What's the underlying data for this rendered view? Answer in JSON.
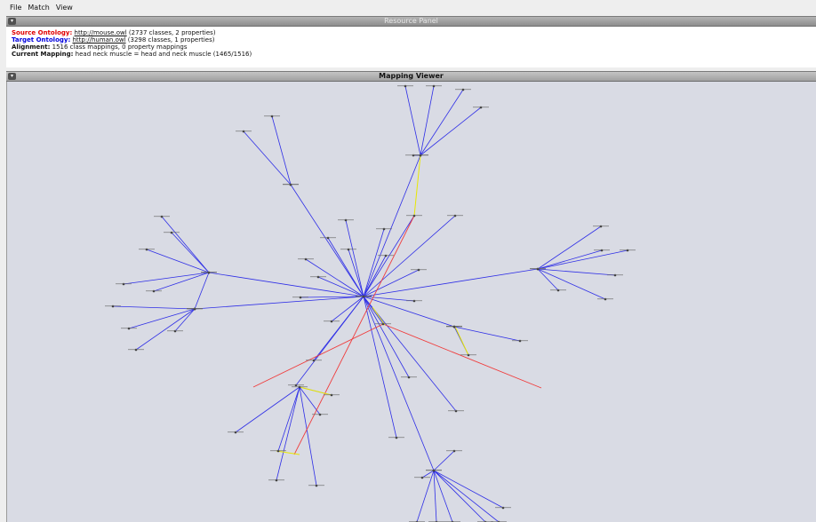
{
  "menu": [
    "File",
    "Match",
    "View"
  ],
  "resource_panel": {
    "title": "Resource Panel",
    "source_label": "Source Ontology:",
    "source_link": "http://mouse.owl",
    "source_info": " (2737 classes, 2 properties)",
    "target_label": "Target Ontology:",
    "target_link": "http://human.owl",
    "target_info": " (3298 classes, 1 properties)",
    "alignment_label": "Alignment:",
    "alignment_info": " 1516 class mappings, 0 property mappings",
    "current_label": "Current Mapping:",
    "current_info": " head neck muscle = head and neck muscle (1465/1516)"
  },
  "mapping_viewer": {
    "title": "Mapping Viewer"
  },
  "colors": {
    "hierarchy_edge": "#2e2ee6",
    "mapping_edge": "#f03c3c",
    "highlight_edge": "#e8e800",
    "node": "#3a3a3a"
  }
}
